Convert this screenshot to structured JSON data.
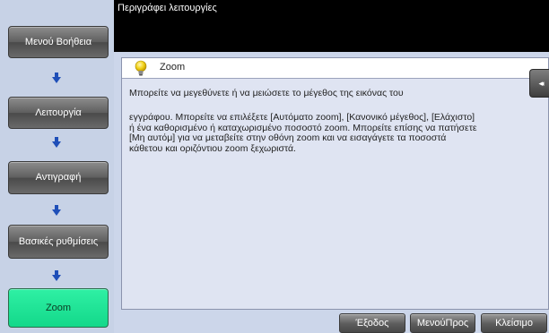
{
  "header": {
    "title": "Περιγράφει λειτουργίες"
  },
  "breadcrumbs": [
    {
      "label": "Μενού Βοήθεια"
    },
    {
      "label": "Λειτουργία"
    },
    {
      "label": "Αντιγραφή"
    },
    {
      "label": "Βασικές ρυθμίσεις"
    },
    {
      "label": "Zoom"
    }
  ],
  "panel": {
    "title": "Zoom",
    "icon": "lightbulb-icon",
    "paragraph1": "Μπορείτε να μεγεθύνετε ή να μειώσετε το μέγεθος της εικόνας του",
    "paragraph2": "εγγράφου. Μπορείτε να επιλέξετε [Αυτόματο zoom], [Κανονικό μέγεθος], [Ελάχιστο] ή ένα καθορισμένο ή καταχωρισμένο ποσοστό zoom. Μπορείτε επίσης να πατήσετε [Μη αυτόμ] για να μεταβείτε στην οθόνη zoom και να εισαγάγετε τα ποσοστά κάθετου και οριζόντιου zoom ξεχωριστά."
  },
  "collapse_tab": {
    "glyph": "◂◂"
  },
  "footer": {
    "exit_label": "Έξοδος",
    "menu_label": "ΜενούΠρος",
    "close_label": "Κλείσιμο"
  },
  "colors": {
    "active_crumb": "#1fe096",
    "sidebar_bg": "#c7d2e6",
    "header_bg": "#000000"
  }
}
